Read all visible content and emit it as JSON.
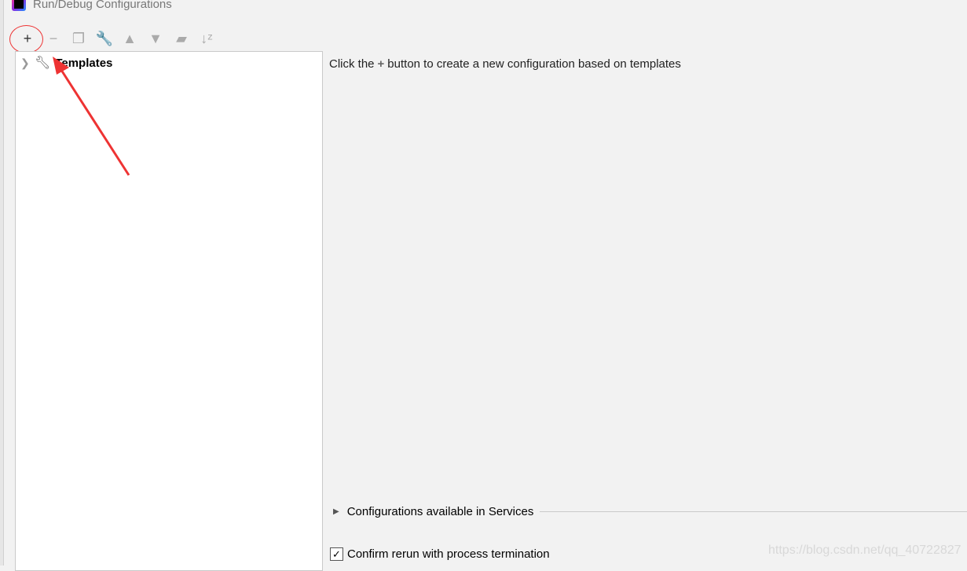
{
  "window": {
    "title": "Run/Debug Configurations"
  },
  "toolbar": [
    {
      "name": "add-button",
      "glyph": "+",
      "enabled": true
    },
    {
      "name": "remove-button",
      "glyph": "−",
      "enabled": false
    },
    {
      "name": "copy-button",
      "glyph": "❐",
      "enabled": false
    },
    {
      "name": "edit-templates-button",
      "glyph": "🔧",
      "enabled": true
    },
    {
      "name": "move-up-button",
      "glyph": "▲",
      "enabled": false
    },
    {
      "name": "move-down-button",
      "glyph": "▼",
      "enabled": false
    },
    {
      "name": "new-folder-button",
      "glyph": "▰",
      "enabled": false
    },
    {
      "name": "sort-button",
      "glyph": "↓ᶻ",
      "enabled": false
    }
  ],
  "tree": {
    "items": [
      {
        "label": "Templates",
        "icon": "wrench-icon",
        "expanded": false
      }
    ]
  },
  "main": {
    "hint_before": "Click the",
    "hint_plus": "+",
    "hint_after": "button to create a new configuration based on templates",
    "services_label": "Configurations available in Services",
    "confirm_rerun_label": "Confirm rerun with process termination",
    "confirm_rerun_checked": true
  },
  "watermark": "https://blog.csdn.net/qq_40722827",
  "colors": {
    "annotation": "#ee3333"
  }
}
